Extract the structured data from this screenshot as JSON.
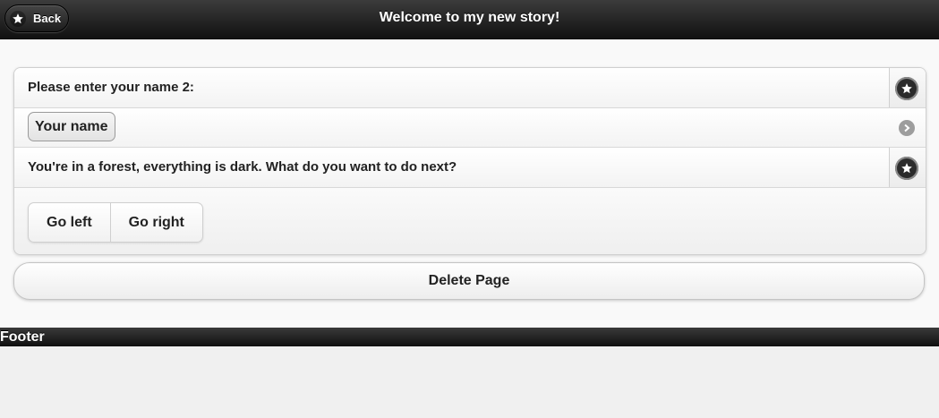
{
  "header": {
    "title": "Welcome to my new story!",
    "back_label": "Back",
    "back_icon": "star-icon"
  },
  "page": {
    "prompt_label": "Please enter your name 2:",
    "prompt_icon": "star-icon",
    "name_value": "Your name",
    "name_icon": "arrow-right-icon",
    "description": "You're in a forest, everything is dark. What do you want to do next?",
    "description_icon": "star-icon",
    "choices": [
      {
        "label": "Go left"
      },
      {
        "label": "Go right"
      }
    ],
    "delete_label": "Delete Page"
  },
  "footer": {
    "text": "Footer"
  },
  "colors": {
    "bar": "#1a1a1a",
    "background": "#f9f9f9",
    "text": "#222222"
  }
}
